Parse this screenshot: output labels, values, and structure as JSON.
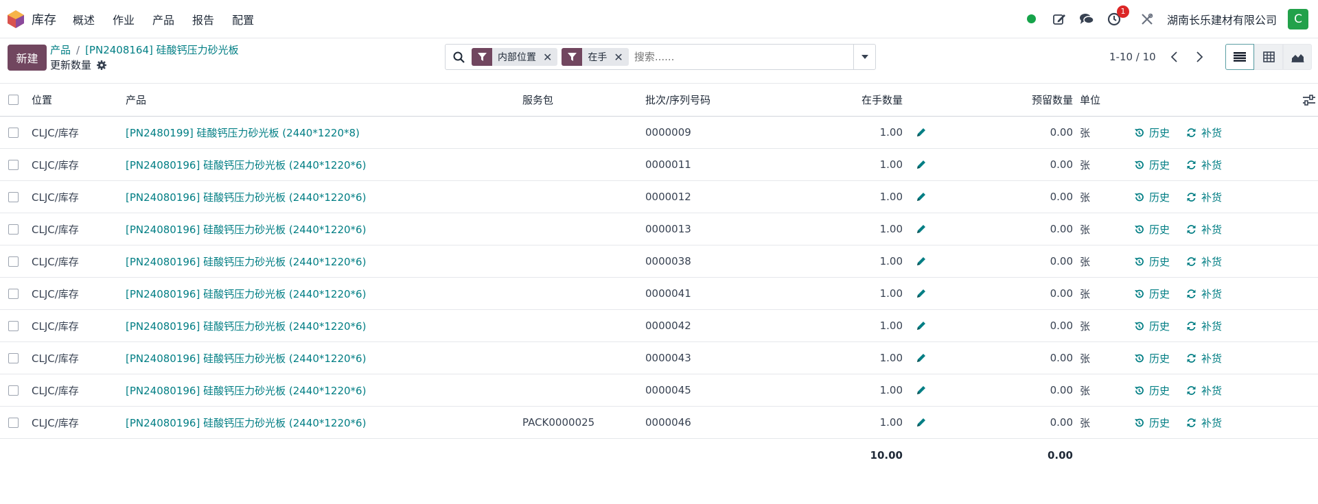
{
  "navbar": {
    "app_name": "库存",
    "menu": [
      "概述",
      "作业",
      "产品",
      "报告",
      "配置"
    ],
    "activity_count": "1",
    "company": "湖南长乐建材有限公司",
    "avatar_letter": "C",
    "status_color": "#16a34a"
  },
  "control": {
    "new_label": "新建",
    "breadcrumb_root": "产品",
    "breadcrumb_current": "[PN2408164] 硅酸钙压力砂光板",
    "subtitle": "更新数量",
    "facets": [
      "内部位置",
      "在手"
    ],
    "search_placeholder": "搜索......",
    "pager": "1-10 / 10"
  },
  "table": {
    "headers": {
      "location": "位置",
      "product": "产品",
      "package": "服务包",
      "lot": "批次/序列号码",
      "on_hand": "在手数量",
      "reserved": "预留数量",
      "uom": "单位"
    },
    "action_history": "历史",
    "action_replenish": "补货",
    "rows": [
      {
        "location": "CLJC/库存",
        "product": "[PN2480199] 硅酸钙压力砂光板 (2440*1220*8)",
        "package": "",
        "lot": "0000009",
        "on_hand": "1.00",
        "reserved": "0.00",
        "uom": "张"
      },
      {
        "location": "CLJC/库存",
        "product": "[PN24080196] 硅酸钙压力砂光板 (2440*1220*6)",
        "package": "",
        "lot": "0000011",
        "on_hand": "1.00",
        "reserved": "0.00",
        "uom": "张"
      },
      {
        "location": "CLJC/库存",
        "product": "[PN24080196] 硅酸钙压力砂光板 (2440*1220*6)",
        "package": "",
        "lot": "0000012",
        "on_hand": "1.00",
        "reserved": "0.00",
        "uom": "张"
      },
      {
        "location": "CLJC/库存",
        "product": "[PN24080196] 硅酸钙压力砂光板 (2440*1220*6)",
        "package": "",
        "lot": "0000013",
        "on_hand": "1.00",
        "reserved": "0.00",
        "uom": "张"
      },
      {
        "location": "CLJC/库存",
        "product": "[PN24080196] 硅酸钙压力砂光板 (2440*1220*6)",
        "package": "",
        "lot": "0000038",
        "on_hand": "1.00",
        "reserved": "0.00",
        "uom": "张"
      },
      {
        "location": "CLJC/库存",
        "product": "[PN24080196] 硅酸钙压力砂光板 (2440*1220*6)",
        "package": "",
        "lot": "0000041",
        "on_hand": "1.00",
        "reserved": "0.00",
        "uom": "张"
      },
      {
        "location": "CLJC/库存",
        "product": "[PN24080196] 硅酸钙压力砂光板 (2440*1220*6)",
        "package": "",
        "lot": "0000042",
        "on_hand": "1.00",
        "reserved": "0.00",
        "uom": "张"
      },
      {
        "location": "CLJC/库存",
        "product": "[PN24080196] 硅酸钙压力砂光板 (2440*1220*6)",
        "package": "",
        "lot": "0000043",
        "on_hand": "1.00",
        "reserved": "0.00",
        "uom": "张"
      },
      {
        "location": "CLJC/库存",
        "product": "[PN24080196] 硅酸钙压力砂光板 (2440*1220*6)",
        "package": "",
        "lot": "0000045",
        "on_hand": "1.00",
        "reserved": "0.00",
        "uom": "张"
      },
      {
        "location": "CLJC/库存",
        "product": "[PN24080196] 硅酸钙压力砂光板 (2440*1220*6)",
        "package": "PACK0000025",
        "lot": "0000046",
        "on_hand": "1.00",
        "reserved": "0.00",
        "uom": "张"
      }
    ],
    "totals": {
      "on_hand": "10.00",
      "reserved": "0.00"
    }
  }
}
